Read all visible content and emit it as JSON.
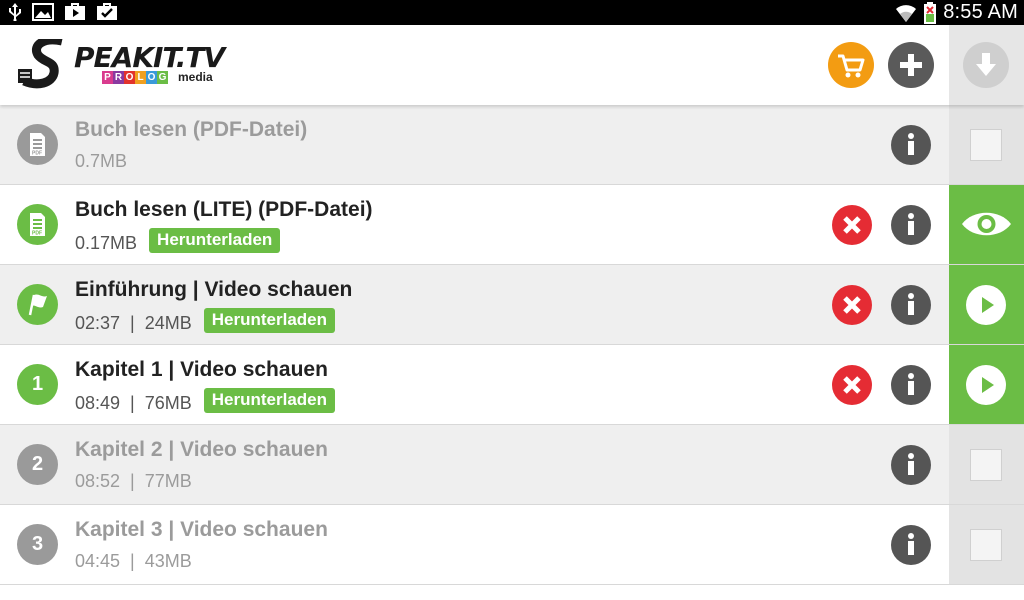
{
  "status_bar": {
    "time": "8:55 AM"
  },
  "header": {
    "logo": {
      "main": "PEAKIT.TV",
      "strip": [
        "P",
        "R",
        "O",
        "L",
        "O",
        "G"
      ],
      "strip_colors": [
        "#d93b8e",
        "#8a3aa0",
        "#e2332c",
        "#f0a020",
        "#3a9ad9",
        "#6bbd45"
      ],
      "media": "media"
    },
    "cart_icon": "cart-icon",
    "add_icon": "plus-icon",
    "download_icon": "download-icon",
    "colors": {
      "cart": "#f39c12",
      "accent": "#6bbd45",
      "delete": "#e52c34"
    }
  },
  "items": [
    {
      "title": "Buch lesen (PDF-Datei)",
      "meta": "0.7MB",
      "badge": "",
      "icon": "pdf-icon",
      "state": "disabled"
    },
    {
      "title": "Buch lesen (LITE) (PDF-Datei)",
      "meta": "0.17MB",
      "badge": "Herunterladen",
      "icon": "pdf-icon",
      "state": "downloaded",
      "action": "view"
    },
    {
      "title": "Einführung | Video schauen",
      "meta": "02:37  |  24MB",
      "badge": "Herunterladen",
      "icon": "flag-icon",
      "state": "downloaded",
      "action": "play"
    },
    {
      "title": "Kapitel 1 | Video schauen",
      "meta": "08:49  |  76MB",
      "badge": "Herunterladen",
      "icon": "1",
      "state": "downloaded",
      "action": "play"
    },
    {
      "title": "Kapitel 2 | Video schauen",
      "meta": "08:52  |  77MB",
      "badge": "",
      "icon": "2",
      "state": "disabled"
    },
    {
      "title": "Kapitel 3 | Video schauen",
      "meta": "04:45  |  43MB",
      "badge": "",
      "icon": "3",
      "state": "disabled"
    }
  ]
}
